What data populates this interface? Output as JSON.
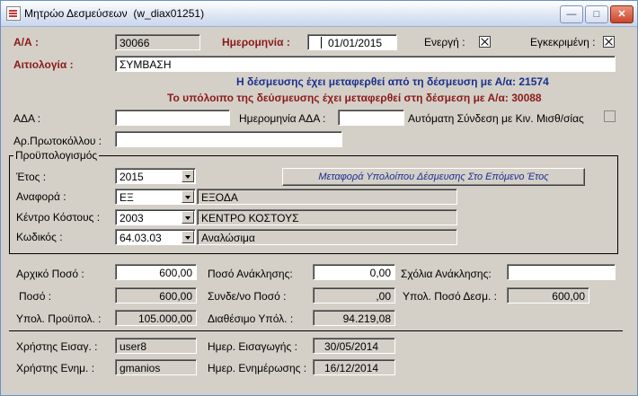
{
  "window": {
    "title": "Μητρώο Δεσμεύσεων",
    "form_id": "(w_diax01251)",
    "buttons": {
      "minimize": "—",
      "maximize": "□",
      "close": "✕"
    }
  },
  "header": {
    "aa_label": "Α/Α :",
    "aa_value": "30066",
    "date_label": "Ημερομηνία :",
    "date_value": "01/01/2015",
    "active_label": "Ενεργή :",
    "active_checked": true,
    "approved_label": "Εγκεκριμένη :",
    "approved_checked": true,
    "reason_label": "Αιτιολογία :",
    "reason_value": "ΣΥΜΒΑΣΗ",
    "msg_transferred_from": "Η δέσμευσης έχει μεταφερθεί από τη δέσμευση με Α/α: 21574",
    "msg_remainder_to": "Το υπόλοιπο της δεύσμευσης έχει μεταφερθεί στη δέσμεση με Α/α: 30088"
  },
  "ada": {
    "ada_label": "ΑΔΑ :",
    "ada_value": "",
    "ada_date_label": "Ημερομηνία ΑΔΑ :",
    "ada_date_value": "",
    "auto_link_label": "Αυτόματη Σύνδεση με Κιν. Μισθ/σίας",
    "auto_link_checked": false,
    "protocol_label": "Αρ.Πρωτοκόλλου :",
    "protocol_value": ""
  },
  "budget": {
    "group_title": "Προϋπολογισμός",
    "year_label": "Έτος :",
    "year_value": "2015",
    "transfer_button": "Μεταφορά Υπολοίπου Δέσμευσης Στο Επόμενο Έτος",
    "ref_label": "Αναφορά :",
    "ref_value": "ΕΞ",
    "ref_desc": "ΕΞΟΔΑ",
    "cost_center_label": "Κέντρο Κόστους :",
    "cost_center_value": "2003",
    "cost_center_desc": "ΚΕΝΤΡΟ ΚΟΣΤΟΥΣ",
    "code_label": "Κωδικός :",
    "code_value": "64.03.03",
    "code_desc": "Αναλώσιμα"
  },
  "amounts": {
    "initial_label": "Αρχικό Ποσό :",
    "initial_value": "600,00",
    "recall_label": "Ποσό Ανάκλησης:",
    "recall_value": "0,00",
    "recall_comments_label": "Σχόλια Ανάκλησης:",
    "recall_comments_value": "",
    "amount_label": "Ποσό :",
    "amount_value": "600,00",
    "linked_label": "Συνδε/νο Ποσό :",
    "linked_value": ",00",
    "remaining_label": "Υπολ. Ποσό Δεσμ. :",
    "remaining_value": "600,00",
    "budget_remaining_label": "Υπολ. Προϋπολ. :",
    "budget_remaining_value": "105.000,00",
    "available_label": "Διαθέσιμο Υπόλ. :",
    "available_value": "94.219,08"
  },
  "audit": {
    "insert_user_label": "Χρήστης Εισαγ. :",
    "insert_user_value": "user8",
    "insert_date_label": "Ημερ. Εισαγωγής :",
    "insert_date_value": "30/05/2014",
    "update_user_label": "Χρήστης Ενημ. :",
    "update_user_value": "gmanios",
    "update_date_label": "Ημερ. Ενημέρωσης :",
    "update_date_value": "16/12/2014"
  }
}
